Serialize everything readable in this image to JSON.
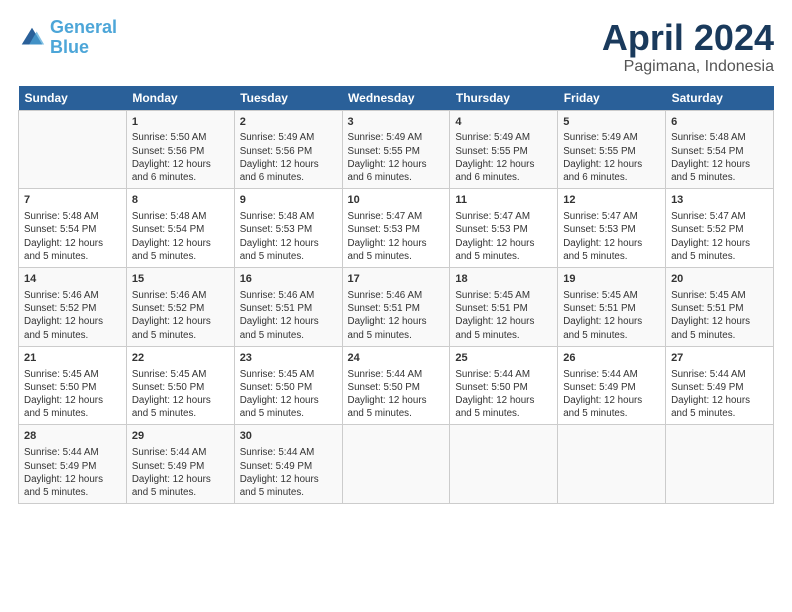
{
  "header": {
    "title": "April 2024",
    "subtitle": "Pagimana, Indonesia",
    "logo_general": "General",
    "logo_blue": "Blue"
  },
  "days_of_week": [
    "Sunday",
    "Monday",
    "Tuesday",
    "Wednesday",
    "Thursday",
    "Friday",
    "Saturday"
  ],
  "weeks": [
    [
      {
        "day": "",
        "info": ""
      },
      {
        "day": "1",
        "info": "Sunrise: 5:50 AM\nSunset: 5:56 PM\nDaylight: 12 hours\nand 6 minutes."
      },
      {
        "day": "2",
        "info": "Sunrise: 5:49 AM\nSunset: 5:56 PM\nDaylight: 12 hours\nand 6 minutes."
      },
      {
        "day": "3",
        "info": "Sunrise: 5:49 AM\nSunset: 5:55 PM\nDaylight: 12 hours\nand 6 minutes."
      },
      {
        "day": "4",
        "info": "Sunrise: 5:49 AM\nSunset: 5:55 PM\nDaylight: 12 hours\nand 6 minutes."
      },
      {
        "day": "5",
        "info": "Sunrise: 5:49 AM\nSunset: 5:55 PM\nDaylight: 12 hours\nand 6 minutes."
      },
      {
        "day": "6",
        "info": "Sunrise: 5:48 AM\nSunset: 5:54 PM\nDaylight: 12 hours\nand 5 minutes."
      }
    ],
    [
      {
        "day": "7",
        "info": "Sunrise: 5:48 AM\nSunset: 5:54 PM\nDaylight: 12 hours\nand 5 minutes."
      },
      {
        "day": "8",
        "info": "Sunrise: 5:48 AM\nSunset: 5:54 PM\nDaylight: 12 hours\nand 5 minutes."
      },
      {
        "day": "9",
        "info": "Sunrise: 5:48 AM\nSunset: 5:53 PM\nDaylight: 12 hours\nand 5 minutes."
      },
      {
        "day": "10",
        "info": "Sunrise: 5:47 AM\nSunset: 5:53 PM\nDaylight: 12 hours\nand 5 minutes."
      },
      {
        "day": "11",
        "info": "Sunrise: 5:47 AM\nSunset: 5:53 PM\nDaylight: 12 hours\nand 5 minutes."
      },
      {
        "day": "12",
        "info": "Sunrise: 5:47 AM\nSunset: 5:53 PM\nDaylight: 12 hours\nand 5 minutes."
      },
      {
        "day": "13",
        "info": "Sunrise: 5:47 AM\nSunset: 5:52 PM\nDaylight: 12 hours\nand 5 minutes."
      }
    ],
    [
      {
        "day": "14",
        "info": "Sunrise: 5:46 AM\nSunset: 5:52 PM\nDaylight: 12 hours\nand 5 minutes."
      },
      {
        "day": "15",
        "info": "Sunrise: 5:46 AM\nSunset: 5:52 PM\nDaylight: 12 hours\nand 5 minutes."
      },
      {
        "day": "16",
        "info": "Sunrise: 5:46 AM\nSunset: 5:51 PM\nDaylight: 12 hours\nand 5 minutes."
      },
      {
        "day": "17",
        "info": "Sunrise: 5:46 AM\nSunset: 5:51 PM\nDaylight: 12 hours\nand 5 minutes."
      },
      {
        "day": "18",
        "info": "Sunrise: 5:45 AM\nSunset: 5:51 PM\nDaylight: 12 hours\nand 5 minutes."
      },
      {
        "day": "19",
        "info": "Sunrise: 5:45 AM\nSunset: 5:51 PM\nDaylight: 12 hours\nand 5 minutes."
      },
      {
        "day": "20",
        "info": "Sunrise: 5:45 AM\nSunset: 5:51 PM\nDaylight: 12 hours\nand 5 minutes."
      }
    ],
    [
      {
        "day": "21",
        "info": "Sunrise: 5:45 AM\nSunset: 5:50 PM\nDaylight: 12 hours\nand 5 minutes."
      },
      {
        "day": "22",
        "info": "Sunrise: 5:45 AM\nSunset: 5:50 PM\nDaylight: 12 hours\nand 5 minutes."
      },
      {
        "day": "23",
        "info": "Sunrise: 5:45 AM\nSunset: 5:50 PM\nDaylight: 12 hours\nand 5 minutes."
      },
      {
        "day": "24",
        "info": "Sunrise: 5:44 AM\nSunset: 5:50 PM\nDaylight: 12 hours\nand 5 minutes."
      },
      {
        "day": "25",
        "info": "Sunrise: 5:44 AM\nSunset: 5:50 PM\nDaylight: 12 hours\nand 5 minutes."
      },
      {
        "day": "26",
        "info": "Sunrise: 5:44 AM\nSunset: 5:49 PM\nDaylight: 12 hours\nand 5 minutes."
      },
      {
        "day": "27",
        "info": "Sunrise: 5:44 AM\nSunset: 5:49 PM\nDaylight: 12 hours\nand 5 minutes."
      }
    ],
    [
      {
        "day": "28",
        "info": "Sunrise: 5:44 AM\nSunset: 5:49 PM\nDaylight: 12 hours\nand 5 minutes."
      },
      {
        "day": "29",
        "info": "Sunrise: 5:44 AM\nSunset: 5:49 PM\nDaylight: 12 hours\nand 5 minutes."
      },
      {
        "day": "30",
        "info": "Sunrise: 5:44 AM\nSunset: 5:49 PM\nDaylight: 12 hours\nand 5 minutes."
      },
      {
        "day": "",
        "info": ""
      },
      {
        "day": "",
        "info": ""
      },
      {
        "day": "",
        "info": ""
      },
      {
        "day": "",
        "info": ""
      }
    ]
  ]
}
